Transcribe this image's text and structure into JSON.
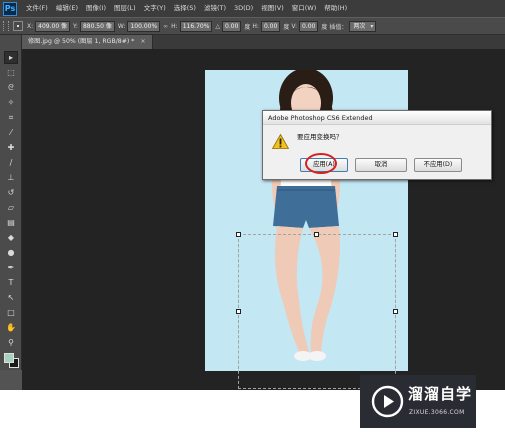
{
  "app": {
    "logo": "Ps"
  },
  "menu": [
    "文件(F)",
    "编辑(E)",
    "图像(I)",
    "图层(L)",
    "文字(Y)",
    "选择(S)",
    "滤镜(T)",
    "3D(D)",
    "视图(V)",
    "窗口(W)",
    "帮助(H)"
  ],
  "options": {
    "x_label": "X:",
    "x_value": "409.00 像",
    "y_label": "Y:",
    "y_value": "880.50 像",
    "w_label": "W:",
    "w_value": "100.00%",
    "link_label": "∞",
    "h_label": "H:",
    "h_value": "116.70%",
    "rotate_label": "△",
    "rotate_value": "0.00",
    "rotate_unit": "度",
    "hskew_label": "H:",
    "hskew_value": "0.00",
    "hskew_unit": "度",
    "vskew_label": "V:",
    "vskew_value": "0.00",
    "vskew_unit": "度",
    "interp_label": "插值：",
    "interp_value": "两次"
  },
  "document": {
    "tab_label": "修图.jpg @ 50% (图层 1, RGB/8#) *",
    "close": "×"
  },
  "tools": [
    {
      "icon": "move-icon",
      "glyph": "▸"
    },
    {
      "icon": "marquee-icon",
      "glyph": "⬚"
    },
    {
      "icon": "lasso-icon",
      "glyph": "ᘓ"
    },
    {
      "icon": "quick-select-icon",
      "glyph": "✧"
    },
    {
      "icon": "crop-icon",
      "glyph": "⌗"
    },
    {
      "icon": "eyedropper-icon",
      "glyph": "⁄"
    },
    {
      "icon": "healing-icon",
      "glyph": "✚"
    },
    {
      "icon": "brush-icon",
      "glyph": "∕"
    },
    {
      "icon": "stamp-icon",
      "glyph": "⊥"
    },
    {
      "icon": "history-brush-icon",
      "glyph": "↺"
    },
    {
      "icon": "eraser-icon",
      "glyph": "▱"
    },
    {
      "icon": "gradient-icon",
      "glyph": "▤"
    },
    {
      "icon": "blur-icon",
      "glyph": "◆"
    },
    {
      "icon": "dodge-icon",
      "glyph": "●"
    },
    {
      "icon": "pen-icon",
      "glyph": "✒"
    },
    {
      "icon": "type-icon",
      "glyph": "T"
    },
    {
      "icon": "path-select-icon",
      "glyph": "↖"
    },
    {
      "icon": "shape-icon",
      "glyph": "□"
    },
    {
      "icon": "hand-icon",
      "glyph": "✋"
    },
    {
      "icon": "zoom-icon",
      "glyph": "⚲"
    }
  ],
  "colors": {
    "foreground": "#a8d2c0",
    "background": "#1a1a1a",
    "photo_bg": "#c4e7f4"
  },
  "dialog": {
    "title": "Adobe Photoshop CS6 Extended",
    "message": "要应用变换吗？",
    "apply": "应用(A)",
    "cancel": "取消",
    "dont_apply": "不应用(D)"
  },
  "watermark": {
    "title": "溜溜自学",
    "subtitle": "ZIXUE.3066.COM"
  }
}
